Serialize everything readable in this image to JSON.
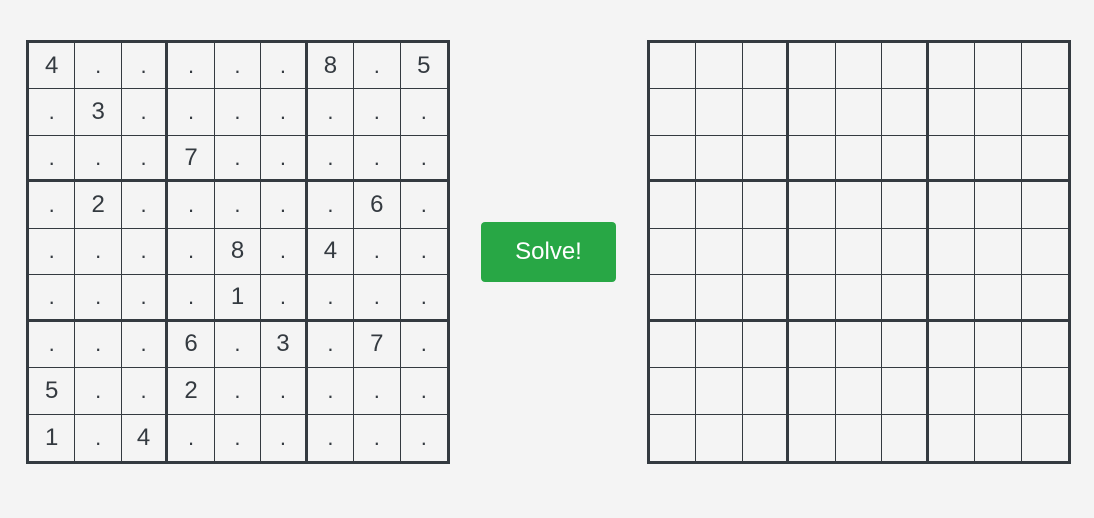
{
  "puzzle": {
    "rows": [
      [
        "4",
        ".",
        ".",
        ".",
        ".",
        ".",
        "8",
        ".",
        "5"
      ],
      [
        ".",
        "3",
        ".",
        ".",
        ".",
        ".",
        ".",
        ".",
        "."
      ],
      [
        ".",
        ".",
        ".",
        "7",
        ".",
        ".",
        ".",
        ".",
        "."
      ],
      [
        ".",
        "2",
        ".",
        ".",
        ".",
        ".",
        ".",
        "6",
        "."
      ],
      [
        ".",
        ".",
        ".",
        ".",
        "8",
        ".",
        "4",
        ".",
        "."
      ],
      [
        ".",
        ".",
        ".",
        ".",
        "1",
        ".",
        ".",
        ".",
        "."
      ],
      [
        ".",
        ".",
        ".",
        "6",
        ".",
        "3",
        ".",
        "7",
        "."
      ],
      [
        "5",
        ".",
        ".",
        "2",
        ".",
        ".",
        ".",
        ".",
        "."
      ],
      [
        "1",
        ".",
        "4",
        ".",
        ".",
        ".",
        ".",
        ".",
        "."
      ]
    ]
  },
  "solve_button": {
    "label": "Solve!"
  },
  "solution": {
    "rows": [
      [
        "",
        "",
        "",
        "",
        "",
        "",
        "",
        "",
        ""
      ],
      [
        "",
        "",
        "",
        "",
        "",
        "",
        "",
        "",
        ""
      ],
      [
        "",
        "",
        "",
        "",
        "",
        "",
        "",
        "",
        ""
      ],
      [
        "",
        "",
        "",
        "",
        "",
        "",
        "",
        "",
        ""
      ],
      [
        "",
        "",
        "",
        "",
        "",
        "",
        "",
        "",
        ""
      ],
      [
        "",
        "",
        "",
        "",
        "",
        "",
        "",
        "",
        ""
      ],
      [
        "",
        "",
        "",
        "",
        "",
        "",
        "",
        "",
        ""
      ],
      [
        "",
        "",
        "",
        "",
        "",
        "",
        "",
        "",
        ""
      ],
      [
        "",
        "",
        "",
        "",
        "",
        "",
        "",
        "",
        ""
      ]
    ]
  },
  "colors": {
    "grid_line": "#343a40",
    "background": "#f4f4f4",
    "button_bg": "#28a745",
    "button_text": "#ffffff"
  }
}
